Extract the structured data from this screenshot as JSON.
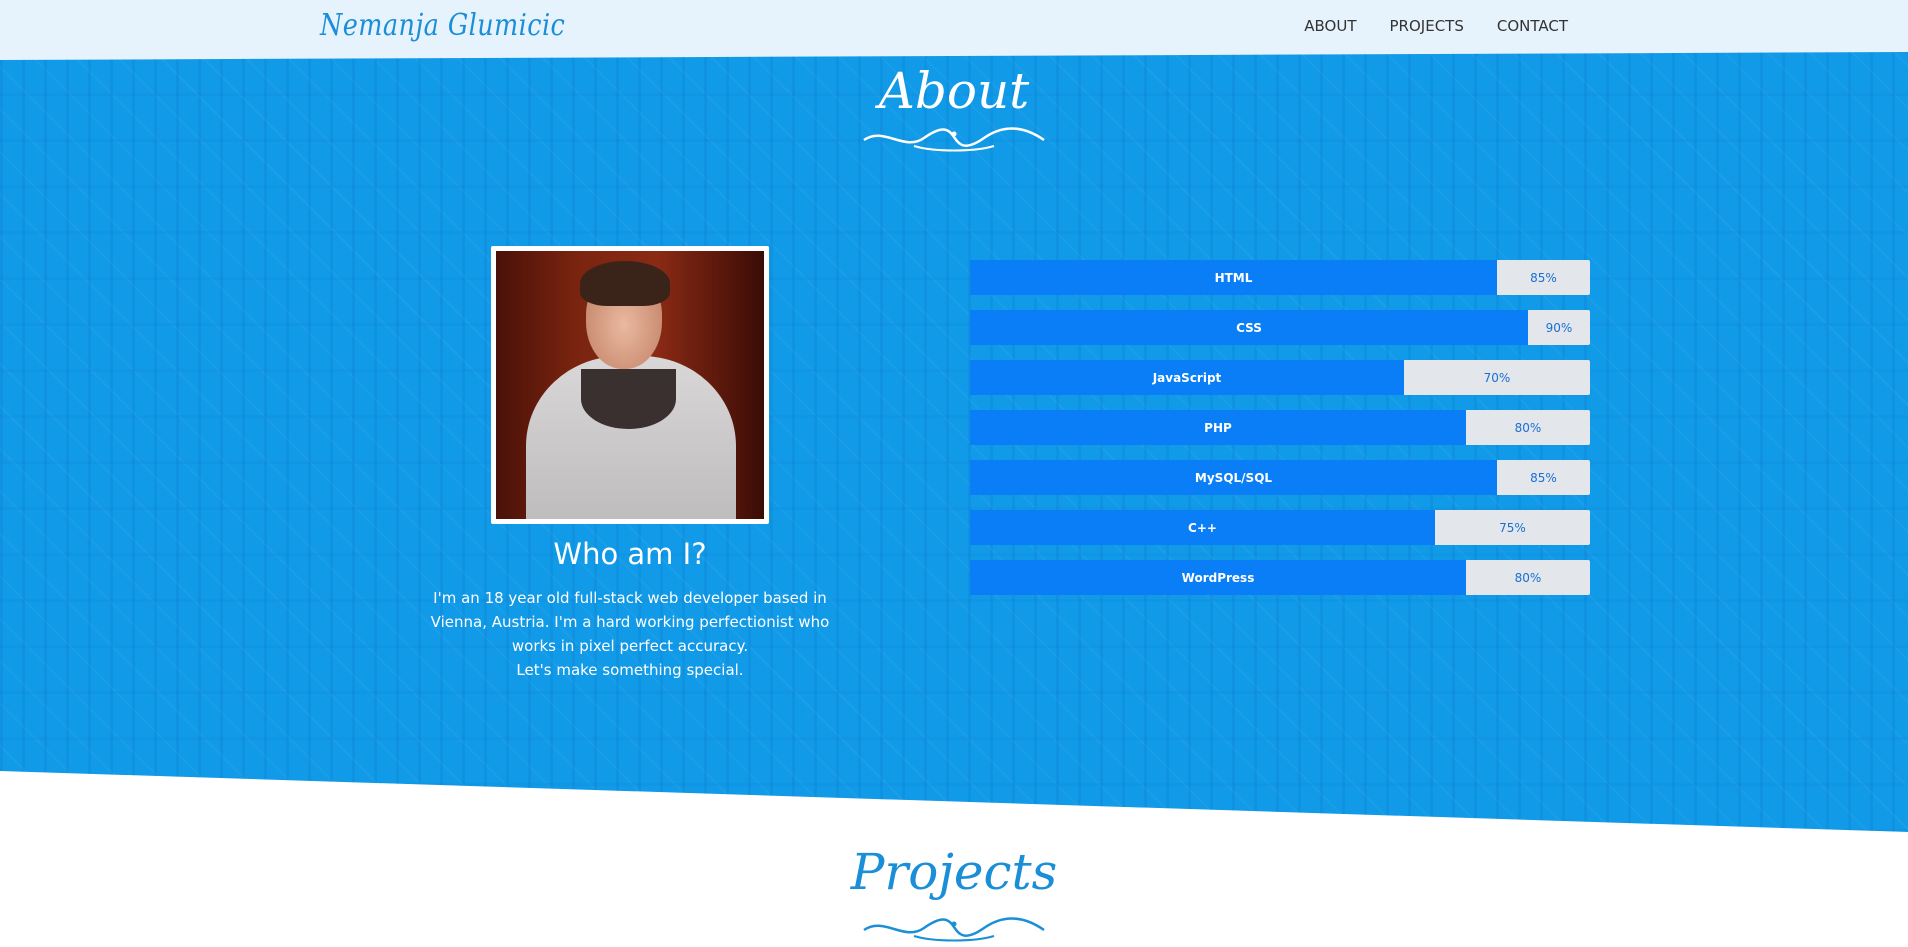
{
  "header": {
    "brand": "Nemanja Glumicic",
    "nav": [
      {
        "label": "ABOUT"
      },
      {
        "label": "PROJECTS"
      },
      {
        "label": "CONTACT"
      }
    ]
  },
  "about": {
    "title": "About",
    "who_title": "Who am I?",
    "bio_lines": [
      "I'm an 18 year old full-stack web developer based in",
      "Vienna, Austria. I'm a hard working perfectionist who",
      "works in pixel perfect accuracy.",
      "Let's make something special."
    ],
    "skills": [
      {
        "name": "HTML",
        "level": 85,
        "label": "85%"
      },
      {
        "name": "CSS",
        "level": 90,
        "label": "90%"
      },
      {
        "name": "JavaScript",
        "level": 70,
        "label": "70%"
      },
      {
        "name": "PHP",
        "level": 80,
        "label": "80%"
      },
      {
        "name": "MySQL/SQL",
        "level": 85,
        "label": "85%"
      },
      {
        "name": "C++",
        "level": 75,
        "label": "75%"
      },
      {
        "name": "WordPress",
        "level": 80,
        "label": "80%"
      }
    ]
  },
  "projects": {
    "title": "Projects"
  },
  "colors": {
    "accent": "#119ae8",
    "skill_fill": "#0a7ef7",
    "skill_track": "#e3e7ec",
    "brand_text": "#1a8fd8"
  },
  "icons": {
    "flourish": "ornamental-flourish-icon"
  }
}
